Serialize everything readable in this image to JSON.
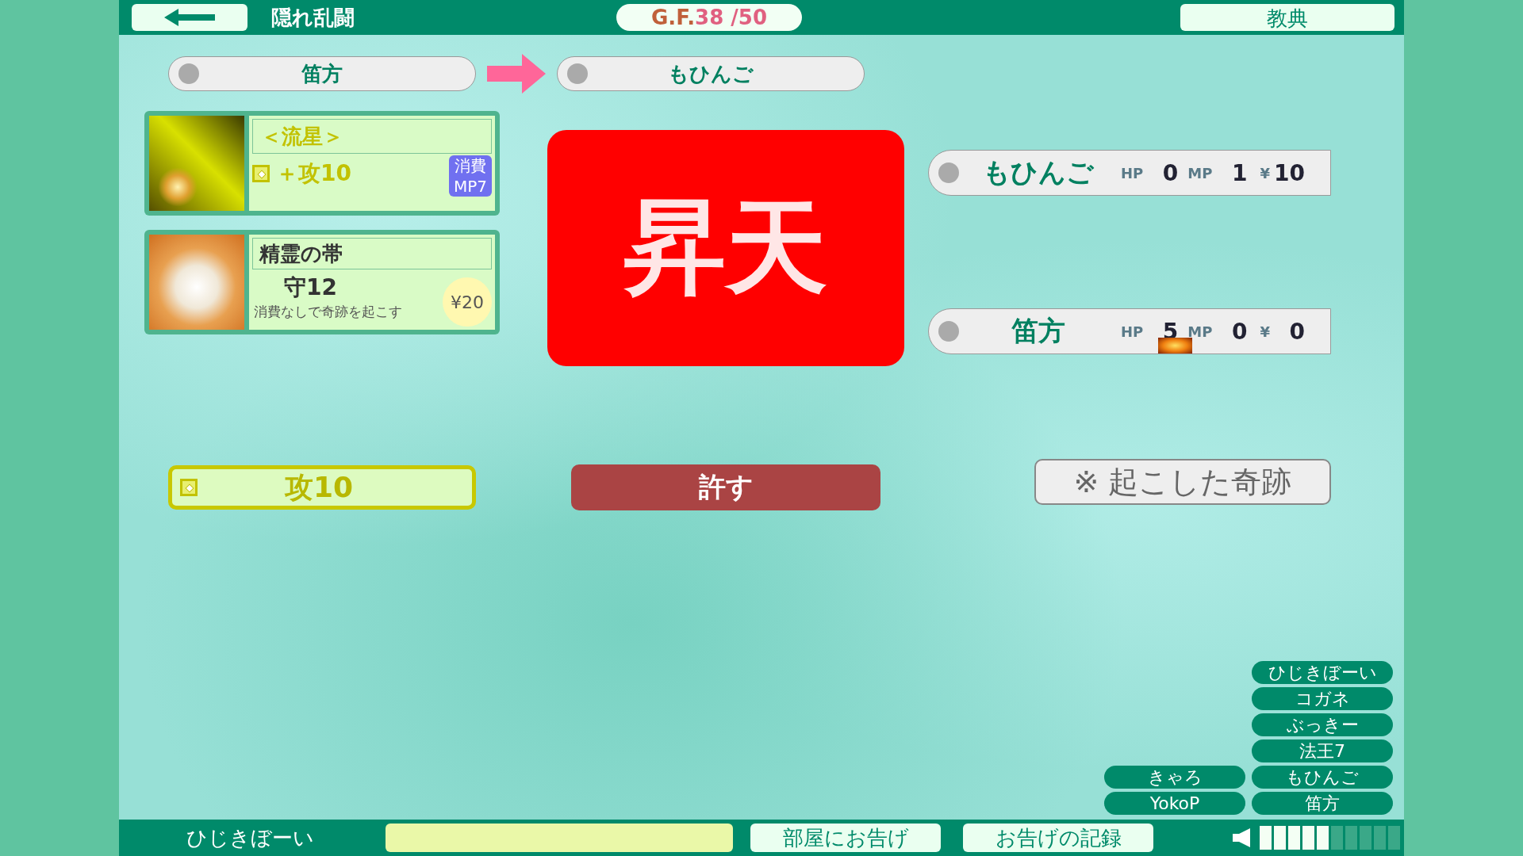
{
  "top_bar": {
    "title": "隠れ乱闘",
    "counter": {
      "label": "G.F.",
      "value": "38 /50"
    },
    "glossary_button": "教典"
  },
  "transfer": {
    "from": "笛方",
    "to": "もひんご"
  },
  "cards": [
    {
      "kind": "miracle",
      "title": "＜流星＞",
      "effect": "＋攻10",
      "cost": [
        "消費",
        "MP7"
      ]
    },
    {
      "kind": "item",
      "title": "精霊の帯",
      "stat": "守12",
      "description": "消費なしで奇跡を起こす",
      "price": "¥20"
    }
  ],
  "result": "昇天",
  "status_rows": [
    {
      "name": "もひんご",
      "hp_label": "HP",
      "hp": "0",
      "mp_label": "MP",
      "mp": "1",
      "money_label": "¥",
      "money": "10",
      "burning": false
    },
    {
      "name": "笛方",
      "hp_label": "HP",
      "hp": "5",
      "mp_label": "MP",
      "mp": "0",
      "money_label": "¥",
      "money": "0",
      "burning": true
    }
  ],
  "actions": {
    "effect_badge": "攻10",
    "forgive_button": "許す",
    "miracles_button": "※ 起こした奇跡"
  },
  "players": {
    "column_1": [
      "きゃろ",
      "YokoP"
    ],
    "column_2": [
      "ひじきぼーい",
      "コガネ",
      "ぶっきー",
      "法王7",
      "もひんご",
      "笛方"
    ]
  },
  "bottom_bar": {
    "user": "ひじきぼーい",
    "announce_button": "部屋にお告げ",
    "log_button": "お告げの記録",
    "volume": {
      "level": 0.5
    }
  }
}
